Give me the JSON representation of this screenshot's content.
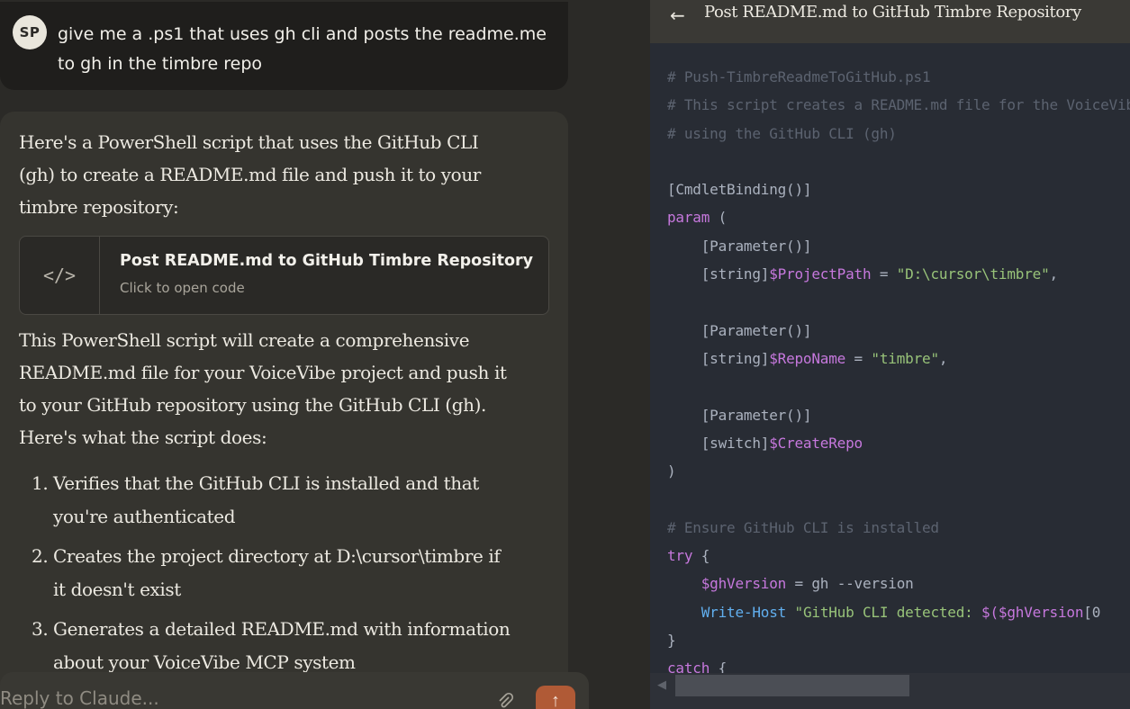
{
  "user": {
    "initials": "SP",
    "message": "give me a .ps1 that uses gh cli and posts the readme.me to gh in the timbre repo"
  },
  "assistant": {
    "intro": "Here's a PowerShell script that uses the GitHub CLI (gh) to create a README.md file and push it to your timbre repository:",
    "artifact": {
      "icon": "</>",
      "title": "Post README.md to GitHub Timbre Repository",
      "subtitle": "Click to open code"
    },
    "body": "This PowerShell script will create a comprehensive README.md file for your VoiceVibe project and push it to your GitHub repository using the GitHub CLI (gh). Here's what the script does:",
    "steps": [
      {
        "num": "1.",
        "text": "Verifies that the GitHub CLI is installed and that you're authenticated"
      },
      {
        "num": "2.",
        "text": "Creates the project directory at D:\\cursor\\timbre if it doesn't exist"
      },
      {
        "num": "3.",
        "text": "Generates a detailed README.md with information about your VoiceVibe MCP system"
      }
    ]
  },
  "reply": {
    "placeholder": "Reply to Claude...",
    "send_icon": "↑"
  },
  "code_panel": {
    "back_icon": "←",
    "title": "Post README.md to GitHub Timbre Repository",
    "lines": [
      [
        {
          "t": "# Push-TimbreReadmeToGitHub.ps1",
          "c": "cm"
        }
      ],
      [
        {
          "t": "# This script creates a README.md file for the VoiceVibe project",
          "c": "cm"
        }
      ],
      [
        {
          "t": "# using the GitHub CLI (gh)",
          "c": "cm"
        }
      ],
      [],
      [
        {
          "t": "[CmdletBinding()]",
          "c": "pl"
        }
      ],
      [
        {
          "t": "param",
          "c": "kw"
        },
        {
          "t": " (",
          "c": "pl"
        }
      ],
      [
        {
          "t": "    [Parameter()]",
          "c": "pl"
        }
      ],
      [
        {
          "t": "    [string]",
          "c": "pl"
        },
        {
          "t": "$ProjectPath",
          "c": "var"
        },
        {
          "t": " = ",
          "c": "pl"
        },
        {
          "t": "\"D:\\cursor\\timbre\"",
          "c": "str"
        },
        {
          "t": ",",
          "c": "pl"
        }
      ],
      [],
      [
        {
          "t": "    [Parameter()]",
          "c": "pl"
        }
      ],
      [
        {
          "t": "    [string]",
          "c": "pl"
        },
        {
          "t": "$RepoName",
          "c": "var"
        },
        {
          "t": " = ",
          "c": "pl"
        },
        {
          "t": "\"timbre\"",
          "c": "str"
        },
        {
          "t": ",",
          "c": "pl"
        }
      ],
      [],
      [
        {
          "t": "    [Parameter()]",
          "c": "pl"
        }
      ],
      [
        {
          "t": "    [switch]",
          "c": "pl"
        },
        {
          "t": "$CreateRepo",
          "c": "var"
        }
      ],
      [
        {
          "t": ")",
          "c": "pl"
        }
      ],
      [],
      [
        {
          "t": "# Ensure GitHub CLI is installed",
          "c": "cm"
        }
      ],
      [
        {
          "t": "try",
          "c": "kw"
        },
        {
          "t": " {",
          "c": "pl"
        }
      ],
      [
        {
          "t": "    ",
          "c": "pl"
        },
        {
          "t": "$ghVersion",
          "c": "var"
        },
        {
          "t": " = gh ",
          "c": "pl"
        },
        {
          "t": "--version",
          "c": "pl"
        }
      ],
      [
        {
          "t": "    ",
          "c": "pl"
        },
        {
          "t": "Write-Host",
          "c": "fn"
        },
        {
          "t": " ",
          "c": "pl"
        },
        {
          "t": "\"GitHub CLI detected: ",
          "c": "str"
        },
        {
          "t": "$(",
          "c": "var"
        },
        {
          "t": "$ghVersion",
          "c": "var"
        },
        {
          "t": "[0",
          "c": "pl"
        }
      ],
      [
        {
          "t": "}",
          "c": "pl"
        }
      ],
      [
        {
          "t": "catch",
          "c": "kw"
        },
        {
          "t": " {",
          "c": "pl"
        }
      ]
    ]
  }
}
